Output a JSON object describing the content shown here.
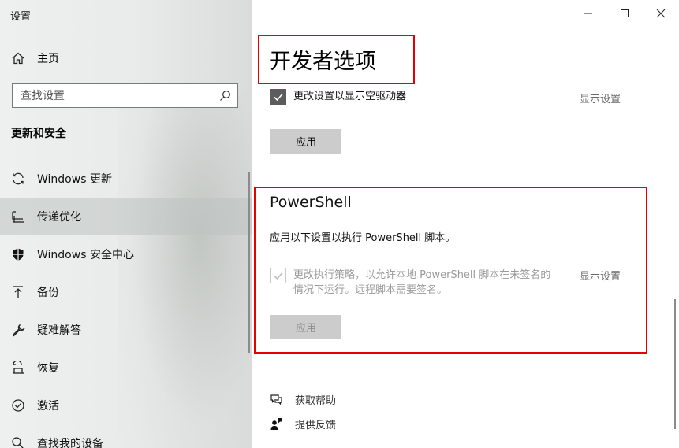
{
  "sidebar": {
    "app_title": "设置",
    "home_label": "主页",
    "home_icon": "home-icon",
    "search_placeholder": "查找设置",
    "search_icon": "search-icon",
    "section_title": "更新和安全",
    "items": [
      {
        "label": "Windows 更新",
        "icon": "sync-icon",
        "selected": false
      },
      {
        "label": "传递优化",
        "icon": "delivery-optimization-icon",
        "selected": true
      },
      {
        "label": "Windows 安全中心",
        "icon": "shield-icon",
        "selected": false
      },
      {
        "label": "备份",
        "icon": "backup-arrow-icon",
        "selected": false
      },
      {
        "label": "疑难解答",
        "icon": "wrench-icon",
        "selected": false
      },
      {
        "label": "恢复",
        "icon": "recovery-icon",
        "selected": false
      },
      {
        "label": "激活",
        "icon": "check-circle-icon",
        "selected": false
      },
      {
        "label": "查找我的设备",
        "icon": "find-device-icon",
        "selected": false
      }
    ]
  },
  "window_controls": {
    "minimize_icon": "minimize-icon",
    "maximize_icon": "maximize-icon",
    "close_icon": "close-icon"
  },
  "main": {
    "page_title": "开发者选项",
    "explorer_setting": {
      "label": "更改设置以显示空驱动器",
      "checked": true,
      "show_settings": "显示设置"
    },
    "apply_label": "应用",
    "powershell": {
      "title": "PowerShell",
      "description": "应用以下设置以执行 PowerShell 脚本。",
      "setting_label_line1": "更改执行策略，以允许本地 PowerShell 脚本在未签名的",
      "setting_label_line2": "情况下运行。远程脚本需要签名。",
      "checked": true,
      "disabled": true,
      "show_settings": "显示设置",
      "apply_label": "应用"
    },
    "help": {
      "get_help": "获取帮助",
      "feedback": "提供反馈"
    }
  },
  "colors": {
    "highlight_box": "#e60000",
    "button_bg": "#cccccc",
    "checkbox_checked": "#5c5c5c"
  }
}
